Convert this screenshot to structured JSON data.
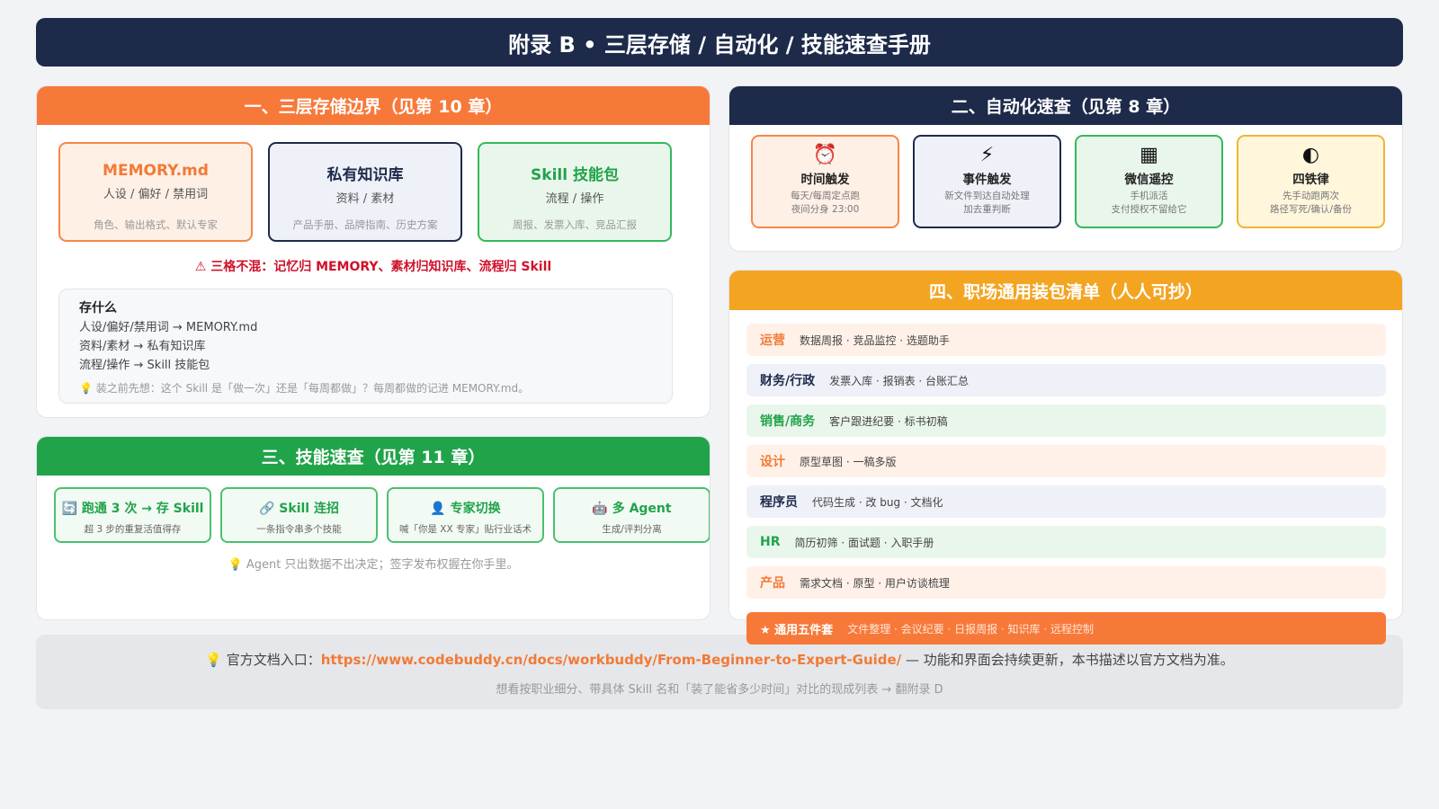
{
  "title": "附录 B • 三层存储 / 自动化 / 技能速查手册",
  "storage": {
    "heading": "一、三层存储边界（见第 10 章）",
    "cards": [
      {
        "title": "MEMORY.md",
        "sub": "人设 / 偏好 / 禁用词",
        "note": "角色、输出格式、默认专家"
      },
      {
        "title": "私有知识库",
        "sub": "资料 / 素材",
        "note": "产品手册、品牌指南、历史方案"
      },
      {
        "title": "Skill 技能包",
        "sub": "流程 / 操作",
        "note": "周报、发票入库、竞品汇报"
      }
    ],
    "warning": "⚠ 三格不混：记忆归 MEMORY、素材归知识库、流程归 Skill",
    "box": {
      "heading": "存什么",
      "lines": [
        "人设/偏好/禁用词 → MEMORY.md",
        "资料/素材 → 私有知识库",
        "流程/操作 → Skill 技能包"
      ],
      "tip": "💡 装之前先想：这个 Skill 是「做一次」还是「每周都做」？每周都做的记进 MEMORY.md。"
    }
  },
  "skills": {
    "heading": "三、技能速查（见第 11 章）",
    "cards": [
      {
        "title": "🔄 跑通 3 次 → 存 Skill",
        "sub": "超 3 步的重复活值得存"
      },
      {
        "title": "🔗 Skill 连招",
        "sub": "一条指令串多个技能"
      },
      {
        "title": "👤 专家切换",
        "sub": "喊「你是 XX 专家」贴行业话术"
      },
      {
        "title": "🤖 多 Agent",
        "sub": "生成/评判分离"
      }
    ],
    "tip": "💡 Agent 只出数据不出决定；签字发布权握在你手里。"
  },
  "automation": {
    "heading": "二、自动化速查（见第 8 章）",
    "cards": [
      {
        "icon": "⏰",
        "title": "时间触发",
        "line1": "每天/每周定点跑",
        "line2": "夜间分身 23:00"
      },
      {
        "icon": "⚡",
        "title": "事件触发",
        "line1": "新文件到达自动处理",
        "line2": "加去重判断"
      },
      {
        "icon": "▦",
        "title": "微信遥控",
        "line1": "手机派活",
        "line2": "支付授权不留给它"
      },
      {
        "icon": "◐",
        "title": "四铁律",
        "line1": "先手动跑两次",
        "line2": "路径写死/确认/备份"
      }
    ]
  },
  "kit": {
    "heading": "四、职场通用装包清单（人人可抄）",
    "rows": [
      {
        "role": "运营",
        "items": "数据周报 · 竞品监控 · 选题助手"
      },
      {
        "role": "财务/行政",
        "items": "发票入库 · 报销表 · 台账汇总"
      },
      {
        "role": "销售/商务",
        "items": "客户跟进纪要 · 标书初稿"
      },
      {
        "role": "设计",
        "items": "原型草图 · 一稿多版"
      },
      {
        "role": "程序员",
        "items": "代码生成 · 改 bug · 文档化"
      },
      {
        "role": "HR",
        "items": "简历初筛 · 面试题 · 入职手册"
      },
      {
        "role": "产品",
        "items": "需求文档 · 原型 · 用户访谈梳理"
      }
    ],
    "five": {
      "role": "★ 通用五件套",
      "items": "文件整理 · 会议纪要 · 日报周报 · 知识库 · 远程控制"
    }
  },
  "footer": {
    "prefix": "💡 官方文档入口：",
    "url": "https://www.codebuddy.cn/docs/workbuddy/From-Beginner-to-Expert-Guide/",
    "suffix": " — 功能和界面会持续更新，本书描述以官方文档为准。",
    "line2": "想看按职业细分、带具体 Skill 名和「装了能省多少时间」对比的现成列表 → 翻附录 D"
  }
}
